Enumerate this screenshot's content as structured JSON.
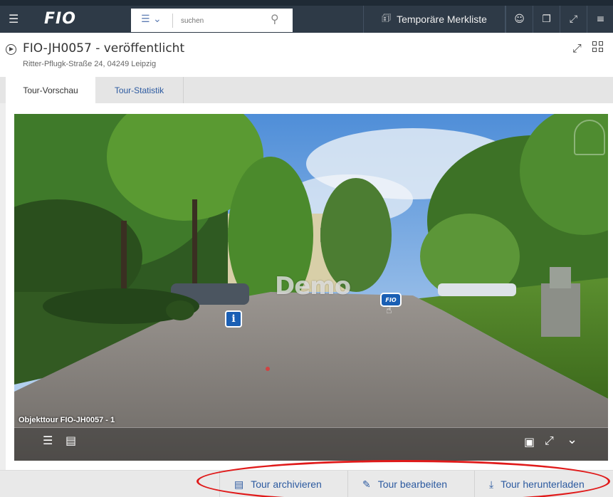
{
  "topbar": {
    "logo": "FIO",
    "search_placeholder": "suchen",
    "merkliste_label": "Temporäre Merkliste"
  },
  "header": {
    "title": "FIO-JH0057 - veröffentlicht",
    "address": "Ritter-Pflugk-Straße 24, 04249 Leipzig"
  },
  "tabs": [
    {
      "label": "Tour-Vorschau",
      "active": true
    },
    {
      "label": "Tour-Statistik",
      "active": false
    }
  ],
  "tour": {
    "watermark": "Demo",
    "hotspot_logo": "FIO",
    "caption": "Objekttour FIO-JH0057 - 1"
  },
  "actions": {
    "archive_label": "Tour archivieren",
    "edit_label": "Tour bearbeiten",
    "download_label": "Tour herunterladen"
  },
  "colors": {
    "nav_bg": "#2e3a47",
    "link_blue": "#2c5aa0",
    "hotspot_blue": "#1a5fb4",
    "highlight_red": "#e01a1a"
  }
}
